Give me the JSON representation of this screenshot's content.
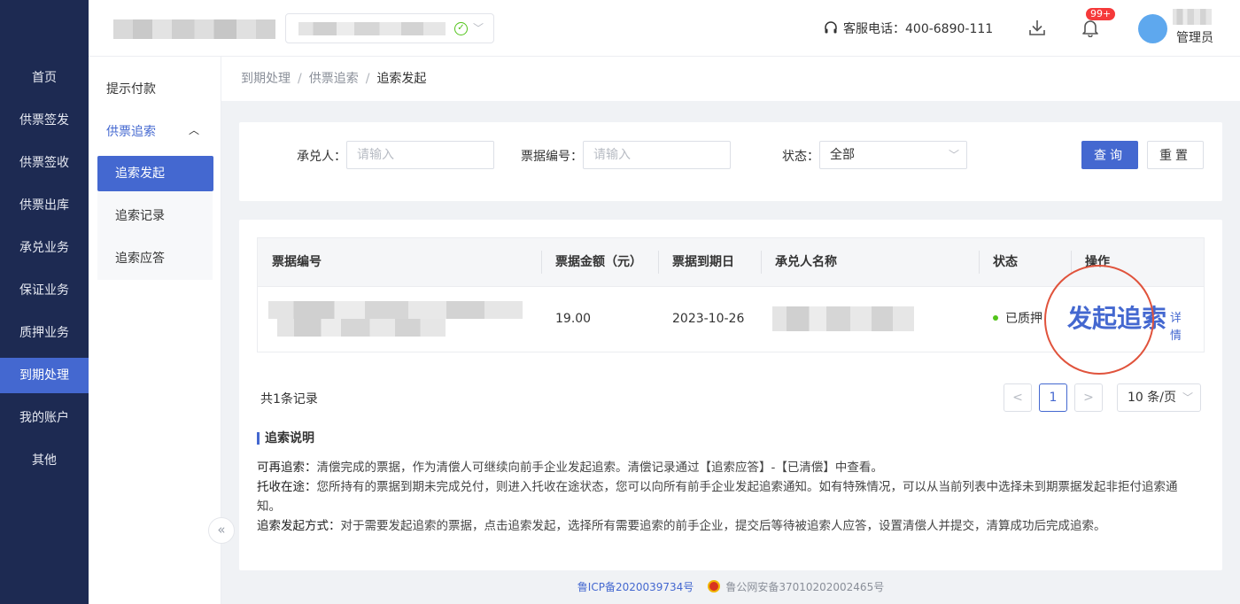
{
  "leftnav": {
    "items": [
      {
        "label": "首页"
      },
      {
        "label": "供票签发"
      },
      {
        "label": "供票签收"
      },
      {
        "label": "供票出库"
      },
      {
        "label": "承兑业务"
      },
      {
        "label": "保证业务"
      },
      {
        "label": "质押业务"
      },
      {
        "label": "到期处理"
      },
      {
        "label": "我的账户"
      },
      {
        "label": "其他"
      }
    ]
  },
  "header": {
    "hotline": "客服电话：400-6890-111",
    "badge": "99+",
    "role": "管理员",
    "icons": [
      "headset-icon",
      "download-icon",
      "bell-icon",
      "check-circle-icon",
      "chevron-down-icon"
    ]
  },
  "subnav": {
    "item_1": "提示付款",
    "group": "供票追索",
    "children": [
      "追索发起",
      "追索记录",
      "追索应答"
    ],
    "collapse": "«"
  },
  "breadcrumb": [
    "到期处理",
    "供票追索",
    "追索发起"
  ],
  "filter": {
    "acceptor_label": "承兑人：",
    "acceptor_placeholder": "请输入",
    "bill_no_label": "票据编号：",
    "bill_no_placeholder": "请输入",
    "status_label": "状态：",
    "status_value": "全部",
    "query": "查询",
    "reset": "重置"
  },
  "table": {
    "headers": [
      "票据编号",
      "票据金额（元）",
      "票据到期日",
      "承兑人名称",
      "状态",
      "操作"
    ],
    "rows": [
      {
        "amount": "19.00",
        "due_date": "2023-10-26",
        "status": "已质押",
        "action": "发起追索",
        "detail": "详情"
      }
    ]
  },
  "pagination": {
    "total": "共1条记录",
    "prev": "<",
    "page": "1",
    "next": ">",
    "page_size": "10 条/页"
  },
  "description": {
    "title": "追索说明",
    "lines": [
      {
        "term": "可再追索：",
        "text": "清偿完成的票据，作为清偿人可继续向前手企业发起追索。清偿记录通过【追索应答】-【已清偿】中查看。"
      },
      {
        "term": "托收在途：",
        "text": "您所持有的票据到期未完成兑付，则进入托收在途状态，您可以向所有前手企业发起追索通知。如有特殊情况，可以从当前列表中选择未到期票据发起非拒付追索通知。"
      },
      {
        "term": "追索发起方式：",
        "text": "对于需要发起追索的票据，点击追索发起，选择所有需要追索的前手企业，提交后等待被追索人应答，设置清偿人并提交，清算成功后完成追索。"
      }
    ]
  },
  "footer": {
    "icp": "鲁ICP备2020039734号",
    "gongan": "鲁公网安备37010202002465号"
  },
  "colors": {
    "nav_bg": "#1d2a52",
    "accent": "#4468d0",
    "status_green": "#52c41a",
    "badge_red": "#f5393a",
    "annotation_red": "#e0533c"
  }
}
